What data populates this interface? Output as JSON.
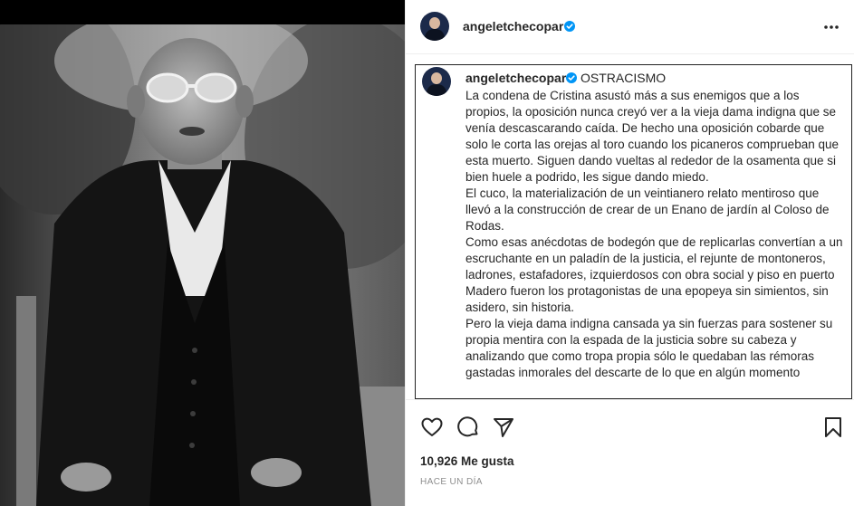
{
  "post": {
    "username": "angeletchecopar",
    "verified": true,
    "caption_title": "OSTRACISMO",
    "caption_paragraphs": [
      "La condena de Cristina asustó más a sus enemigos que a los propios, la oposición nunca creyó ver a la vieja dama indigna que se venía descascarando caída. De hecho una oposición cobarde que solo le corta las orejas al toro cuando los picaneros comprueban que esta muerto. Siguen dando vueltas al rededor de la osamenta que si bien huele a podrido, les sigue dando miedo.",
      "El cuco, la materialización de un veintianero relato mentiroso que llevó a la construcción de crear de un Enano de jardín al Coloso de Rodas.",
      "Como esas anécdotas de bodegón que de replicarlas convertían a un escruchante en un paladín de la justicia, el rejunte de montoneros, ladrones, estafadores, izquierdosos con obra social y piso en puerto Madero fueron los protagonistas de una epopeya sin simientos, sin asidero, sin historia.",
      "Pero la vieja dama indigna cansada ya sin fuerzas para sostener su propia mentira con la espada de la justicia sobre su cabeza y analizando que como tropa propia sólo le quedaban las rémoras gastadas inmorales del descarte de lo que en algún momento"
    ],
    "likes_text": "10,926 Me gusta",
    "timestamp": "HACE UN DÍA"
  },
  "icons": {
    "more": "more-options-icon",
    "like": "heart-icon",
    "comment": "comment-icon",
    "share": "paper-plane-icon",
    "save": "bookmark-icon",
    "verified": "verified-badge-icon"
  },
  "colors": {
    "verified_blue": "#0095f6",
    "text": "#262626",
    "muted": "#8e8e8e"
  }
}
